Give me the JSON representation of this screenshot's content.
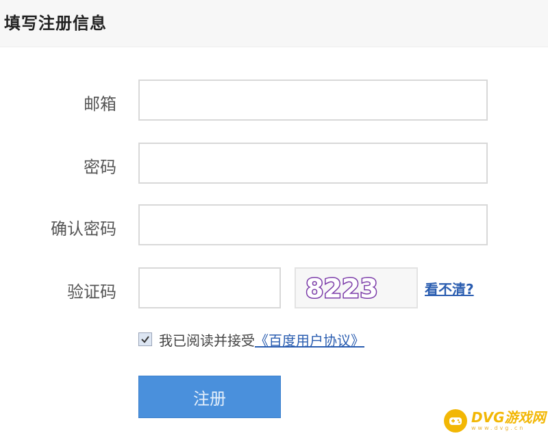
{
  "header": {
    "title": "填写注册信息"
  },
  "form": {
    "email_label": "邮箱",
    "email_value": "",
    "password_label": "密码",
    "password_value": "",
    "confirm_label": "确认密码",
    "confirm_value": "",
    "captcha_label": "验证码",
    "captcha_value": "",
    "captcha_text": "8223",
    "refresh_text": "看不清?",
    "agree_checked": true,
    "agree_text": "我已阅读并接受",
    "agree_link_text": "《百度用户协议》",
    "submit_label": "注册"
  },
  "watermark": {
    "brand": "DVG游戏网",
    "domain": "www.dvg.cn"
  },
  "colors": {
    "accent": "#4a90dc",
    "link": "#2a5db0",
    "brand": "#f2b705"
  }
}
